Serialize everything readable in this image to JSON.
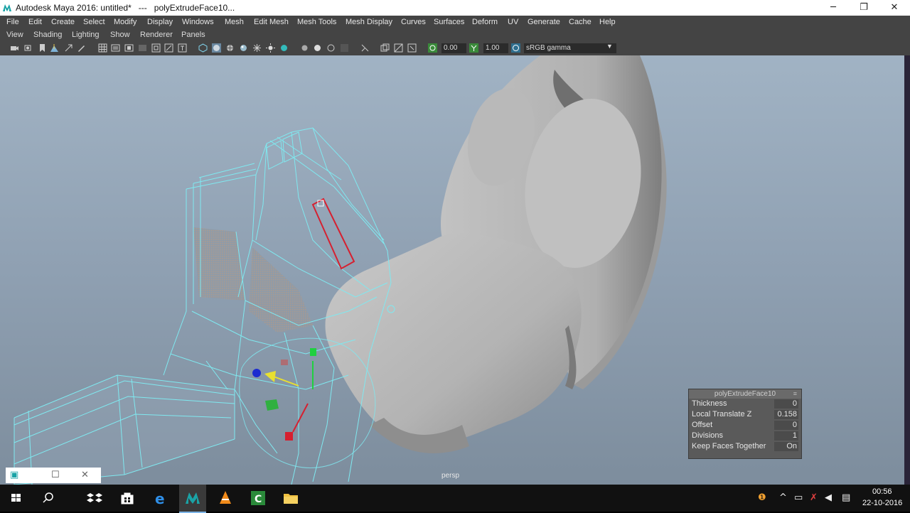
{
  "window": {
    "title": "Autodesk Maya 2016: untitled*   ---   polyExtrudeFace10..."
  },
  "menubar": [
    "File",
    "Edit",
    "Create",
    "Select",
    "Modify",
    "Display",
    "Windows",
    "Mesh",
    "Edit Mesh",
    "Mesh Tools",
    "Mesh Display",
    "Curves",
    "Surfaces",
    "Deform",
    "UV",
    "Generate",
    "Cache",
    "Help"
  ],
  "panel_menu": [
    "View",
    "Shading",
    "Lighting",
    "Show",
    "Renderer",
    "Panels"
  ],
  "toolbar": {
    "exposure": "0.00",
    "gamma": "1.00",
    "color_space": "sRGB gamma"
  },
  "viewport": {
    "camera": "persp"
  },
  "hud": {
    "title": "polyExtrudeFace10",
    "rows": [
      {
        "label": "Thickness",
        "value": "0"
      },
      {
        "label": "Local Translate Z",
        "value": "0.158"
      },
      {
        "label": "Offset",
        "value": "0"
      },
      {
        "label": "Divisions",
        "value": "1"
      },
      {
        "label": "Keep Faces Together",
        "value": "On"
      }
    ]
  },
  "taskbar": {
    "time": "00:56",
    "date": "22-10-2016"
  },
  "colors": {
    "menubar_bg": "#444444",
    "wireframe": "#7fe9f0",
    "selection": "#d62030",
    "viewport_top": "#a1b3c4"
  }
}
